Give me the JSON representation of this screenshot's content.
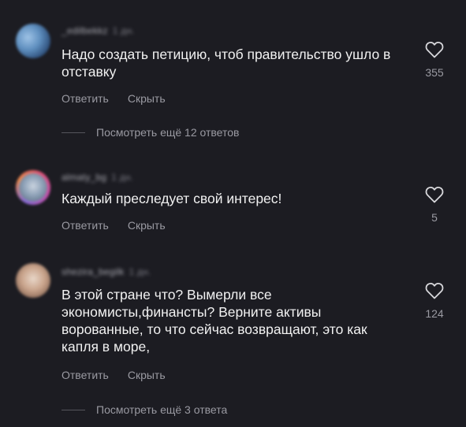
{
  "comments": [
    {
      "username": "_edilbekkz",
      "time": "1 дн.",
      "text": "Надо создать петицию, чтоб правительство ушло в отставку",
      "reply_label": "Ответить",
      "hide_label": "Скрыть",
      "likes": "355",
      "view_more": "Посмотреть ещё 12 ответов"
    },
    {
      "username": "almaty_bg",
      "time": "1 дн.",
      "text": "Каждый преследует свой интерес!",
      "reply_label": "Ответить",
      "hide_label": "Скрыть",
      "likes": "5"
    },
    {
      "username": "shezira_begilk",
      "time": "1 дн.",
      "text": "В этой стране что? Вымерли все экономисты,финансты?  Верните активы ворованные, то что сейчас возвращают, это как капля в море,",
      "reply_label": "Ответить",
      "hide_label": "Скрыть",
      "likes": "124",
      "view_more": "Посмотреть ещё 3 ответа"
    }
  ],
  "icons": {
    "like": "heart-outline-icon"
  },
  "colors": {
    "background": "#1c1c22",
    "text": "#f1f1f1",
    "muted": "#9a9aa2"
  }
}
